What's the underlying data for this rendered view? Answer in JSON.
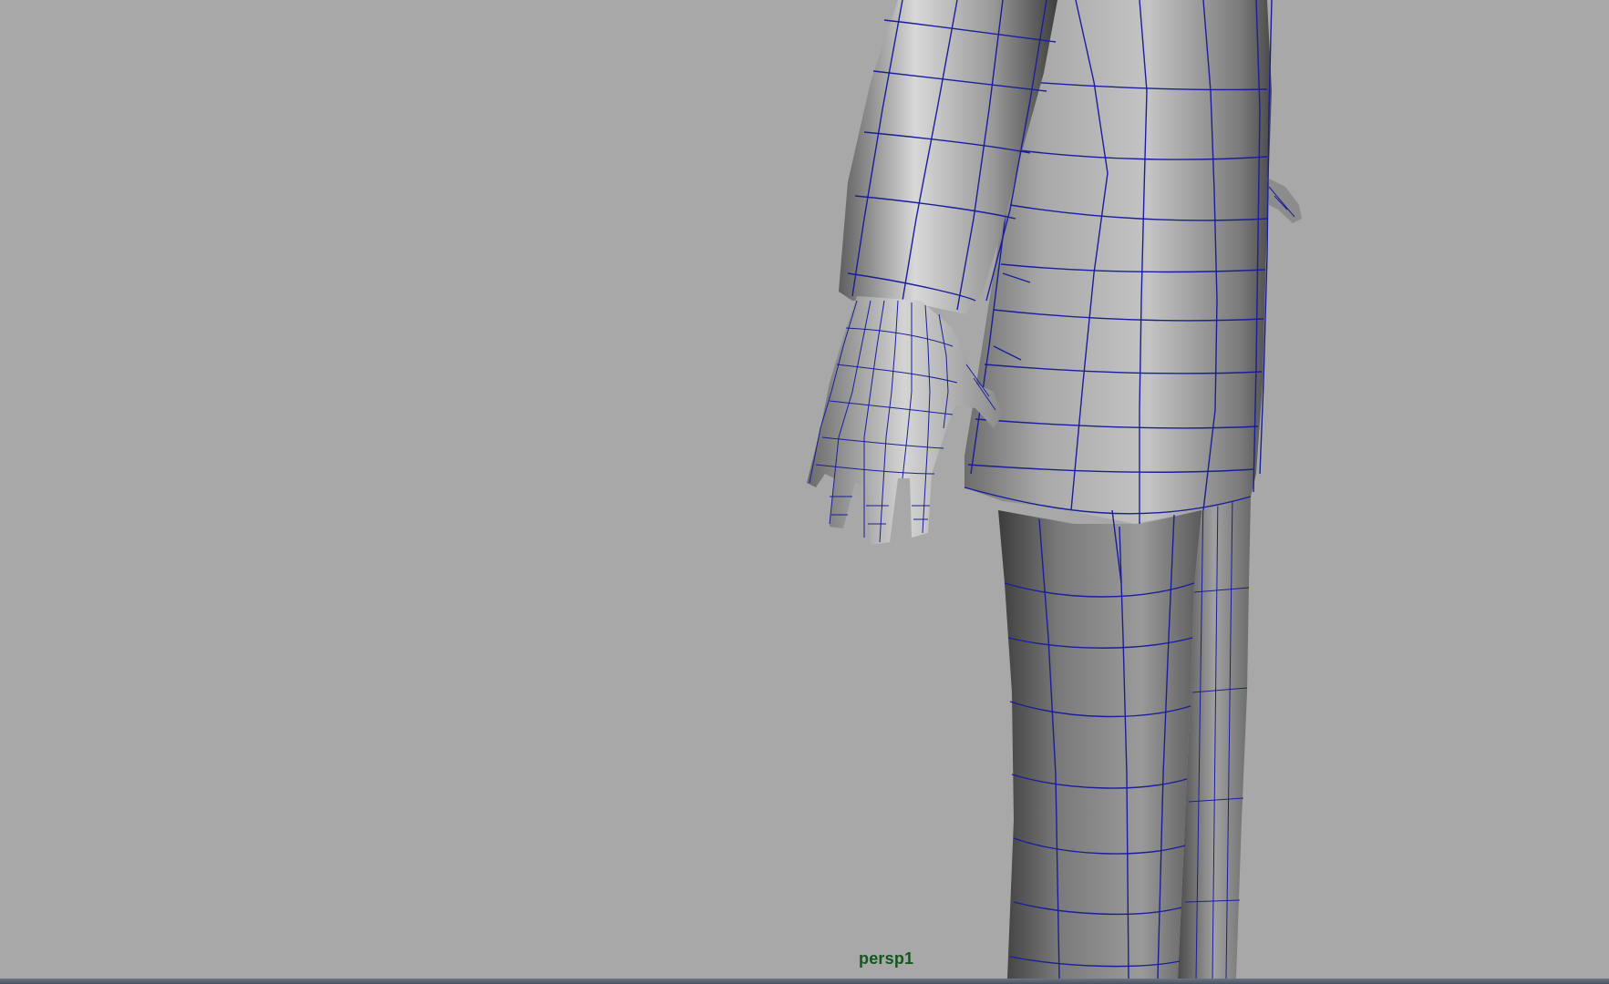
{
  "viewport": {
    "camera_name": "persp1",
    "background_color": "#a8a8a8",
    "wireframe_color": "#1a1e9a",
    "label_color": "#14561f"
  }
}
